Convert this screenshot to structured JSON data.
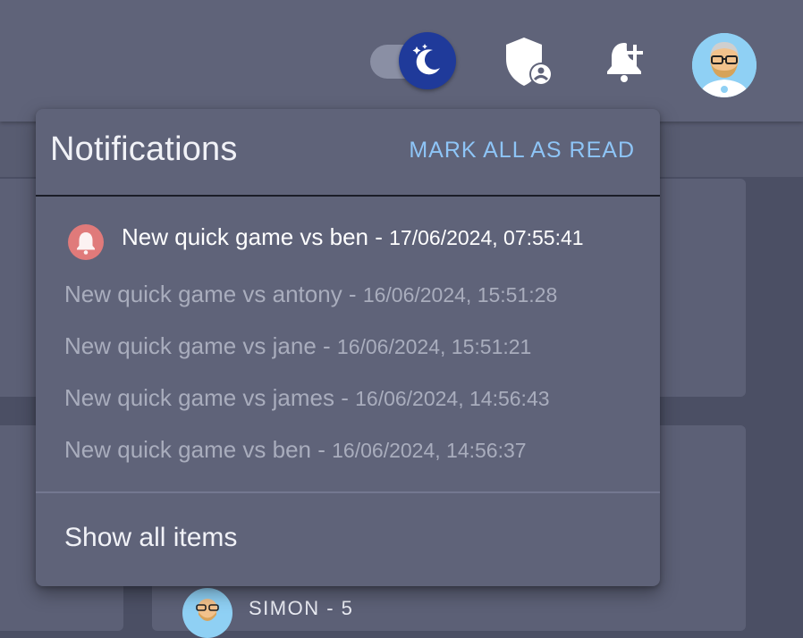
{
  "toolbar": {
    "theme_toggle": {
      "state": "dark",
      "icon": "moon-stars-icon"
    },
    "admin_icon": "shield-user-icon",
    "notifications_icon": "bell-plus-icon",
    "avatar_icon": "user-avatar"
  },
  "notifications": {
    "title": "Notifications",
    "mark_all_label": "MARK ALL AS READ",
    "items": [
      {
        "text": "New quick game vs ben - ",
        "date": "17/06/2024, 07:55:41",
        "unread": true
      },
      {
        "text": "New quick game vs antony - ",
        "date": "16/06/2024, 15:51:28",
        "unread": false
      },
      {
        "text": "New quick game vs jane - ",
        "date": "16/06/2024, 15:51:21",
        "unread": false
      },
      {
        "text": "New quick game vs james - ",
        "date": "16/06/2024, 14:56:43",
        "unread": false
      },
      {
        "text": "New quick game vs ben - ",
        "date": "16/06/2024, 14:56:37",
        "unread": false
      }
    ],
    "show_all_label": "Show all items"
  },
  "leaderboard_peek": {
    "label": "SIMON - 5"
  },
  "colors": {
    "background": "#4b4f64",
    "surface": "#5f6379",
    "accent_link": "#8ec5f7",
    "unread_badge": "#e07a7a",
    "toggle_thumb": "#1f3a9a"
  }
}
